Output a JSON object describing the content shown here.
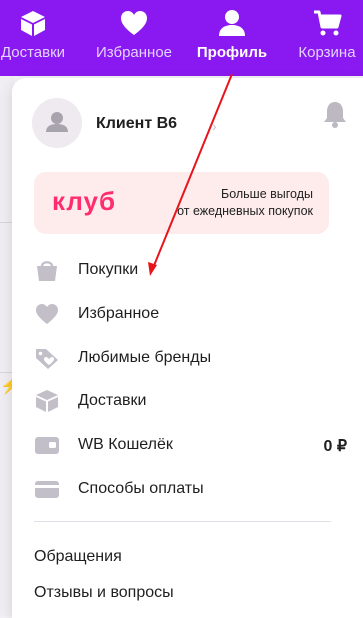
{
  "nav": {
    "items": [
      {
        "label": "Доставки",
        "icon": "box-icon"
      },
      {
        "label": "Избранное",
        "icon": "heart-icon"
      },
      {
        "label": "Профиль",
        "icon": "person-icon"
      },
      {
        "label": "Корзина",
        "icon": "cart-icon"
      }
    ],
    "active": "Профиль",
    "bg_color": "#8a18f0"
  },
  "profile": {
    "name": "Клиент В6",
    "chevron": "›"
  },
  "club": {
    "logo": "клуб",
    "line1": "Больше выгоды",
    "line2": "от ежедневных покупок"
  },
  "menu": {
    "items": [
      {
        "label": "Покупки",
        "icon": "bag-icon"
      },
      {
        "label": "Избранное",
        "icon": "heart-icon"
      },
      {
        "label": "Любимые бренды",
        "icon": "tag-heart-icon"
      },
      {
        "label": "Доставки",
        "icon": "box-icon"
      },
      {
        "label": "WB Кошелёк",
        "icon": "wallet-icon",
        "value": "0 ₽"
      },
      {
        "label": "Способы оплаты",
        "icon": "card-icon"
      }
    ]
  },
  "links": {
    "items": [
      "Обращения",
      "Отзывы и вопросы"
    ]
  },
  "annotation": {
    "arrow_color": "#e8141b"
  }
}
